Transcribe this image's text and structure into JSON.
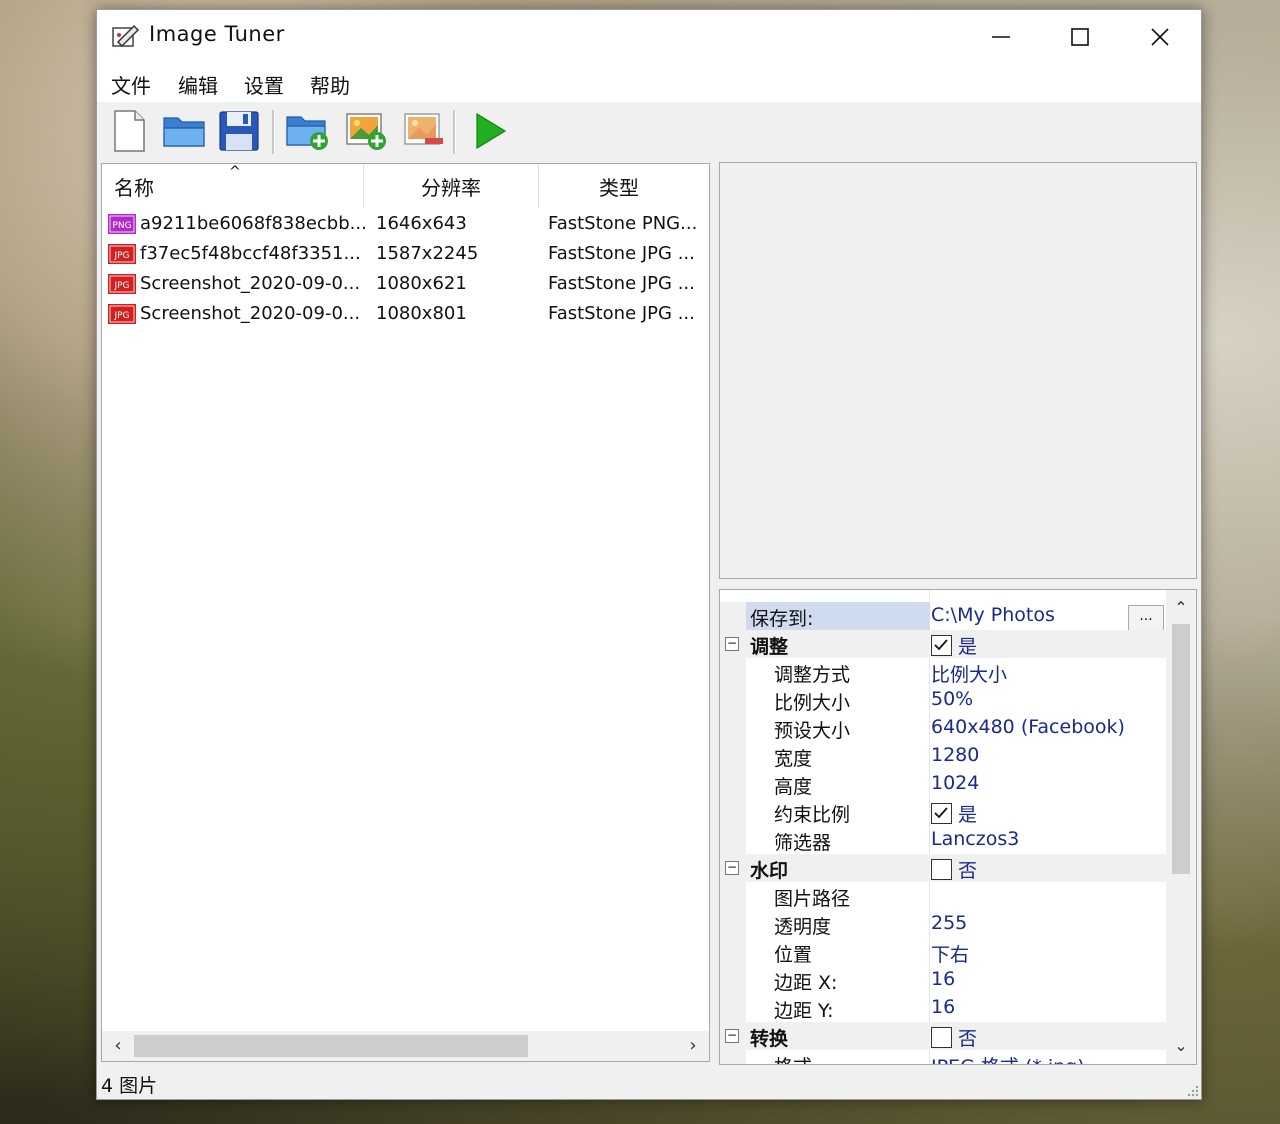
{
  "window": {
    "title": "Image Tuner"
  },
  "menu": [
    "文件",
    "编辑",
    "设置",
    "帮助"
  ],
  "toolbar": {
    "icons": [
      "new-file-icon",
      "open-folder-icon",
      "save-icon",
      "add-folder-icon",
      "add-image-icon",
      "remove-image-icon",
      "play-icon"
    ]
  },
  "file_list": {
    "columns": [
      "名称",
      "分辨率",
      "类型"
    ],
    "rows": [
      {
        "badge": "PNG",
        "name": "a9211be6068f838ecbb...",
        "resolution": "1646x643",
        "type": "FastStone PNG..."
      },
      {
        "badge": "JPG",
        "name": "f37ec5f48bccf48f3351...",
        "resolution": "1587x2245",
        "type": "FastStone JPG ..."
      },
      {
        "badge": "JPG",
        "name": "Screenshot_2020-09-0...",
        "resolution": "1080x621",
        "type": "FastStone JPG ..."
      },
      {
        "badge": "JPG",
        "name": "Screenshot_2020-09-0...",
        "resolution": "1080x801",
        "type": "FastStone JPG ..."
      }
    ]
  },
  "properties": {
    "save_to": {
      "label": "保存到:",
      "value": "C:\\My Photos",
      "button": "..."
    },
    "resize": {
      "label": "调整",
      "checked": true,
      "value": "是",
      "items": [
        {
          "label": "调整方式",
          "value": "比例大小"
        },
        {
          "label": "比例大小",
          "value": "50%"
        },
        {
          "label": "预设大小",
          "value": "640x480 (Facebook)"
        },
        {
          "label": "宽度",
          "value": "1280"
        },
        {
          "label": "高度",
          "value": "1024"
        },
        {
          "label": "约束比例",
          "value": "是",
          "checked": true
        },
        {
          "label": "筛选器",
          "value": "Lanczos3"
        }
      ]
    },
    "watermark": {
      "label": "水印",
      "checked": false,
      "value": "否",
      "items": [
        {
          "label": "图片路径",
          "value": ""
        },
        {
          "label": "透明度",
          "value": "255"
        },
        {
          "label": "位置",
          "value": "下右"
        },
        {
          "label": "边距 X:",
          "value": "16"
        },
        {
          "label": "边距 Y:",
          "value": "16"
        }
      ]
    },
    "convert": {
      "label": "转换",
      "checked": false,
      "value": "否",
      "items": [
        {
          "label": "格式",
          "value": "JPEG 格式 (*.jpg)"
        }
      ]
    }
  },
  "status": {
    "text": "4 图片"
  },
  "colors": {
    "png_badge": "#b02cc8",
    "jpg_badge": "#d02020",
    "accent_green": "#0a7a0a",
    "value_blue": "#1a2a8a"
  }
}
